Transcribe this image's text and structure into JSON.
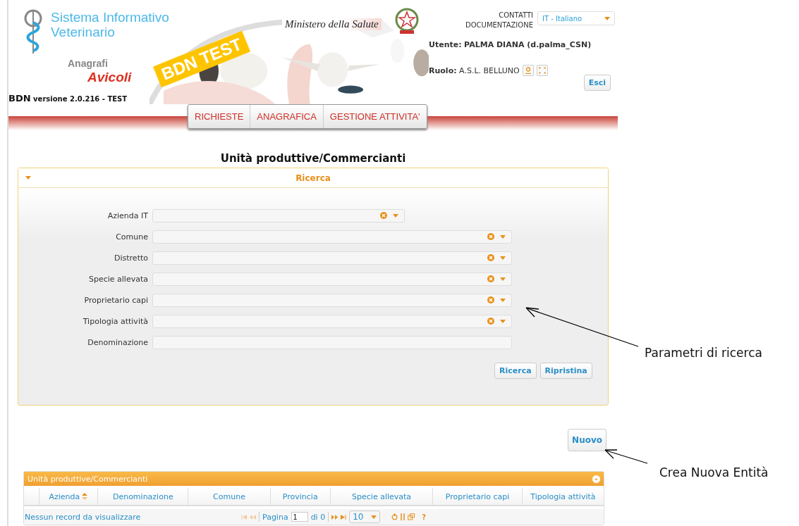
{
  "header": {
    "system_name": [
      "Sistema Informativo",
      "Veterinario"
    ],
    "registry": "Anagrafi",
    "registry_sub": "Avicoli",
    "badge": "BDN TEST",
    "ministry": "Ministero della Salute",
    "version_app": "BDN",
    "version": "versione 2.0.216 - TEST",
    "links": [
      "CONTATTI",
      "DOCUMENTAZIONE"
    ],
    "language": "IT - Italiano",
    "user_label": "Utente:",
    "user": "PALMA DIANA (d.palma_CSN)",
    "role_label": "Ruolo:",
    "role": "A.S.L. BELLUNO",
    "logout": "Esci"
  },
  "menu": [
    "RICHIESTE",
    "ANAGRAFICA",
    "GESTIONE ATTIVITA'"
  ],
  "page_title": "Unità produttive/Commercianti",
  "search": {
    "title": "Ricerca",
    "expanded": true,
    "fields": [
      {
        "label": "Azienda IT",
        "kind": "combo"
      },
      {
        "label": "Comune",
        "kind": "combo"
      },
      {
        "label": "Distretto",
        "kind": "combo"
      },
      {
        "label": "Specie allevata",
        "kind": "combo"
      },
      {
        "label": "Proprietario capi",
        "kind": "combo"
      },
      {
        "label": "Tipologia attività",
        "kind": "combo"
      },
      {
        "label": "Denominazione",
        "kind": "text"
      }
    ],
    "buttons": [
      "Ricerca",
      "Ripristina"
    ]
  },
  "new_button": "Nuovo",
  "grid": {
    "title": "Unità produttive/Commercianti",
    "collapsed": false,
    "columns": [
      {
        "label": "Azienda",
        "sorted": true
      },
      {
        "label": "Denominazione",
        "sorted": false
      },
      {
        "label": "Comune",
        "sorted": false
      },
      {
        "label": "Provincia",
        "sorted": false
      },
      {
        "label": "Specie allevata",
        "sorted": false
      },
      {
        "label": "Proprietario capi",
        "sorted": false
      },
      {
        "label": "Tipologia attività",
        "sorted": false
      }
    ],
    "status": "Nessun record da visualizzare",
    "page_label": "Pagina",
    "page": "1",
    "page_total": "di 0",
    "page_size": "10",
    "help": "?"
  },
  "annotations": [
    "Parametri di ricerca",
    "Crea Nuova Entità"
  ]
}
